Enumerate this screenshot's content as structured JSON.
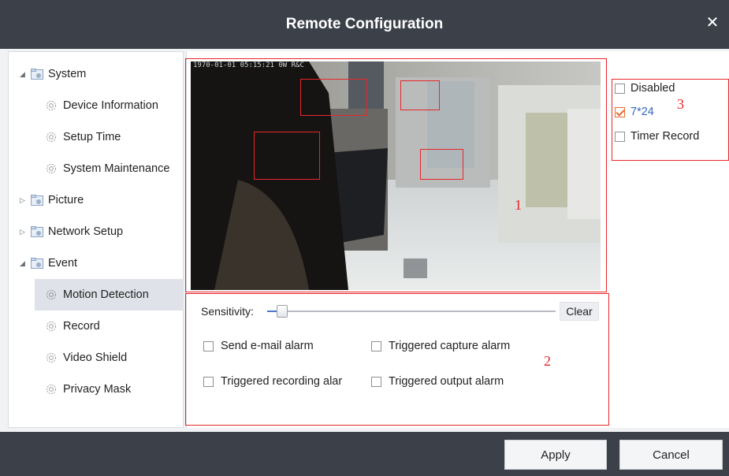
{
  "window": {
    "title": "Remote Configuration",
    "close_glyph": "✕"
  },
  "sidebar": {
    "items": [
      {
        "label": "System",
        "type": "group",
        "expanded": true
      },
      {
        "label": "Device Information",
        "type": "child"
      },
      {
        "label": "Setup Time",
        "type": "child"
      },
      {
        "label": "System Maintenance",
        "type": "child"
      },
      {
        "label": "Picture",
        "type": "group",
        "expanded": false
      },
      {
        "label": "Network Setup",
        "type": "group",
        "expanded": false
      },
      {
        "label": "Event",
        "type": "group",
        "expanded": true
      },
      {
        "label": "Motion Detection",
        "type": "child",
        "selected": true
      },
      {
        "label": "Record",
        "type": "child"
      },
      {
        "label": "Video Shield",
        "type": "child"
      },
      {
        "label": "Privacy Mask",
        "type": "child"
      }
    ]
  },
  "video": {
    "osd": "1970-01-01 05:15:21 0W R&C"
  },
  "annotations": [
    "1",
    "2",
    "3"
  ],
  "sensitivity": {
    "label": "Sensitivity:",
    "clear_label": "Clear"
  },
  "alarms": {
    "send_email": "Send e-mail alarm",
    "triggered_capture": "Triggered capture alarm",
    "triggered_recording": "Triggered recording alar",
    "triggered_output": "Triggered output alarm"
  },
  "schedule": {
    "disabled": "Disabled",
    "always": "7*24",
    "timer": "Timer Record"
  },
  "footer": {
    "apply_label": "Apply",
    "cancel_label": "Cancel"
  },
  "colors": {
    "titlebar": "#3b4049",
    "annotation": "#e8262a",
    "check": "#e96b2f",
    "link_blue": "#3566c2"
  }
}
